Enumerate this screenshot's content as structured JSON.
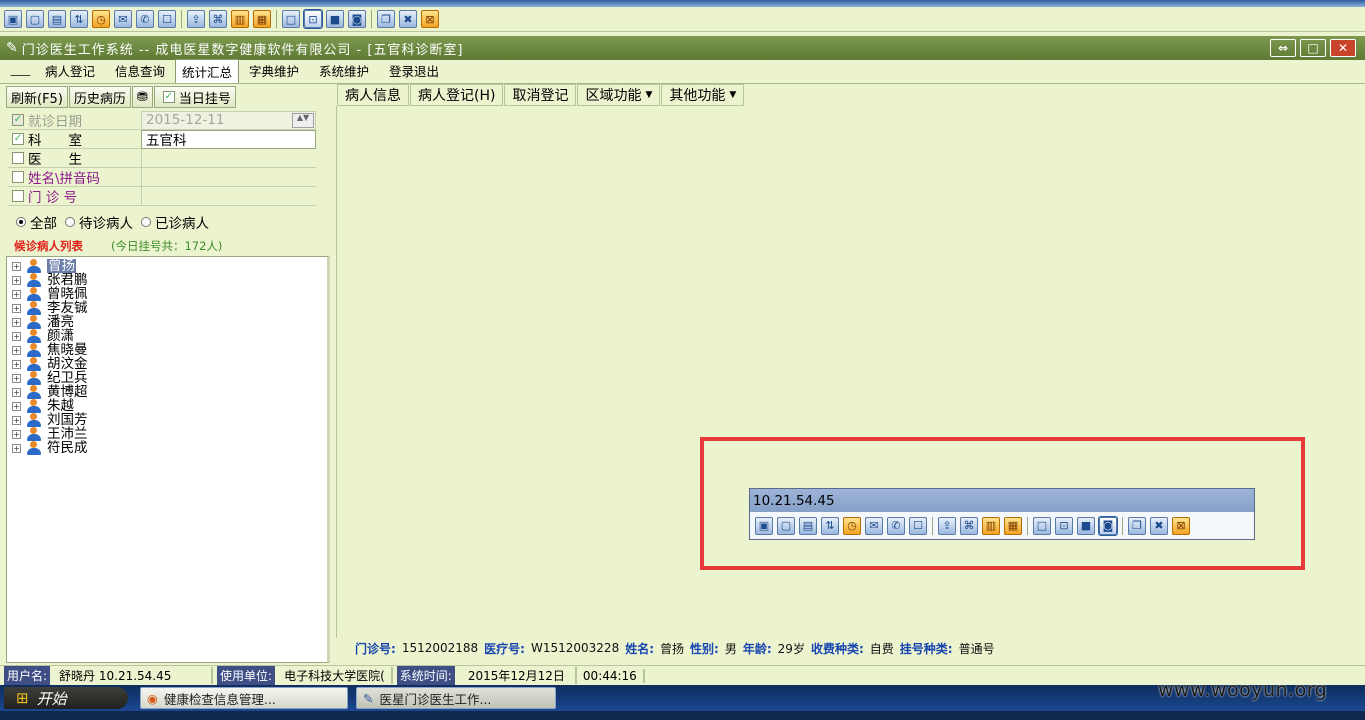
{
  "toolbar": {
    "groups": [
      [
        "monitor-icon",
        "window-icon",
        "terminal-icon",
        "transfer-icon",
        "clock-icon",
        "chat-icon",
        "phone-icon",
        "message-icon"
      ],
      [
        "upload-icon",
        "network-icon",
        "lock-icon",
        "unlock-icon"
      ],
      [
        "window-empty-icon",
        "window-target-icon",
        "window-fill-icon",
        "window-focus-icon"
      ],
      [
        "copy-icon",
        "tools-icon",
        "close-box-icon"
      ]
    ]
  },
  "window": {
    "title": "门诊医生工作系统 -- 成电医星数字健康软件有限公司 - [五官科诊断室]"
  },
  "menu": {
    "items": [
      "病人登记",
      "信息查询",
      "统计汇总",
      "字典维护",
      "系统维护",
      "登录退出"
    ],
    "active": 2
  },
  "left": {
    "buttons": {
      "refresh": "刷新(F5)",
      "history": "历史病历",
      "today": "当日挂号"
    },
    "filters": [
      {
        "label": "就诊日期",
        "checked": true,
        "disabled": true,
        "value": "2015-12-11"
      },
      {
        "label": "科　　室",
        "checked": true,
        "disabled": false,
        "value": "五官科"
      },
      {
        "label": "医　　生",
        "checked": false,
        "disabled": false,
        "value": ""
      },
      {
        "label": "姓名\\拼音码",
        "checked": false,
        "disabled": false,
        "value": ""
      },
      {
        "label": "门 诊 号",
        "checked": false,
        "disabled": false,
        "value": ""
      }
    ],
    "radios": {
      "all": "全部",
      "waiting": "待诊病人",
      "done": "已诊病人"
    },
    "list_title": "候诊病人列表",
    "list_count": "(今日挂号共：172人)",
    "patients": [
      "曾扬",
      "张君鹏",
      "曾晓佩",
      "李友铖",
      "潘亮",
      "颜潇",
      "焦晓曼",
      "胡汶金",
      "纪卫兵",
      "黄博超",
      "朱越",
      "刘国芳",
      "王沛兰",
      "符民成"
    ]
  },
  "right_tabs": {
    "patient_info": "病人信息",
    "register": "病人登记(H)",
    "cancel": "取消登记",
    "region": "区域功能",
    "other": "其他功能"
  },
  "floating_toolbar": {
    "title": "10.21.54.45"
  },
  "patient_info": {
    "outpatient_no_label": "门诊号:",
    "outpatient_no": "1512002188",
    "medical_no_label": "医疗号:",
    "medical_no": "W1512003228",
    "name_label": "姓名:",
    "name": "曾扬",
    "gender_label": "性别:",
    "gender": "男",
    "age_label": "年龄:",
    "age": "29岁",
    "fee_label": "收费种类:",
    "fee": "自费",
    "reg_label": "挂号种类:",
    "reg": "普通号"
  },
  "status": {
    "user_label": "用户名:",
    "user": "舒晓丹 10.21.54.45",
    "unit_label": "使用单位:",
    "unit": "电子科技大学医院(",
    "time_label": "系统时间:",
    "date": "2015年12月12日",
    "time": "00:44:16"
  },
  "taskbar": {
    "start": "开始",
    "tasks": [
      "健康检查信息管理...",
      "医星门诊医生工作..."
    ]
  },
  "watermark": "www.wooyun.org"
}
